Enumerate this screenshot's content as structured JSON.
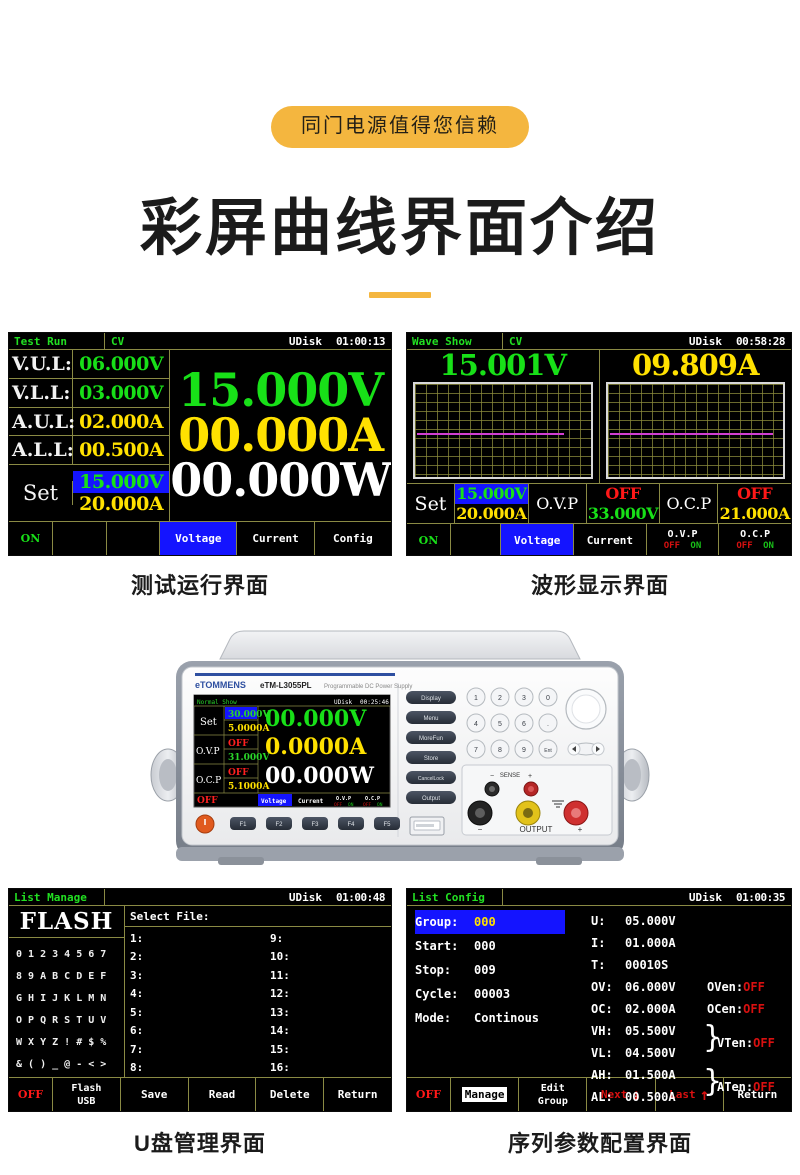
{
  "header": {
    "badge": "同门电源值得您信赖",
    "title": "彩屏曲线界面介绍",
    "accent_color": "#F4B63F"
  },
  "captions": {
    "panel1": "测试运行界面",
    "panel2": "波形显示界面",
    "panel3": "U盘管理界面",
    "panel4": "序列参数配置界面"
  },
  "colors": {
    "green": "#18e018",
    "yellow": "#ffe100",
    "white": "#ffffff",
    "red": "#ff1818",
    "blue_select": "#1414ff",
    "grid_line": "#8a8a44",
    "trace": "#d33fd3"
  },
  "panel_test_run": {
    "status": {
      "mode": "Test Run",
      "cc": "CV",
      "udisk": "UDisk",
      "clock": "01:00:13"
    },
    "limits": [
      {
        "label": "V.U.L:",
        "value": "06.000V",
        "color": "green"
      },
      {
        "label": "V.L.L:",
        "value": "03.000V",
        "color": "green"
      },
      {
        "label": "A.U.L:",
        "value": "02.000A",
        "color": "yellow"
      },
      {
        "label": "A.L.L:",
        "value": "00.500A",
        "color": "yellow"
      }
    ],
    "set": {
      "label": "Set",
      "voltage": "15.000V",
      "current": "20.000A",
      "selected": "voltage"
    },
    "readings": {
      "voltage": "15.000V",
      "current": "00.000A",
      "power": "00.000W"
    },
    "fbar": {
      "output": "ON",
      "keys": [
        "Voltage",
        "Current",
        "Config"
      ],
      "active_key": "Voltage"
    }
  },
  "panel_wave_show": {
    "status": {
      "mode": "Wave Show",
      "cc": "CV",
      "udisk": "UDisk",
      "clock": "00:58:28"
    },
    "plots": [
      {
        "reading": "15.001V",
        "color": "green",
        "trace_fraction": 0.84,
        "trace_y_fraction": 0.53
      },
      {
        "reading": "09.809A",
        "color": "yellow",
        "trace_fraction": 0.93,
        "trace_y_fraction": 0.53
      }
    ],
    "setbar": {
      "set_label": "Set",
      "set_voltage": "15.000V",
      "set_current": "20.000A",
      "ovp_label": "O.V.P",
      "ovp_state": "OFF",
      "ovp_value": "33.000V",
      "ocp_label": "O.C.P",
      "ocp_state": "OFF",
      "ocp_value": "21.000A"
    },
    "fbar": {
      "output": "ON",
      "keys": [
        "Voltage",
        "Current"
      ],
      "active_key": "Voltage",
      "toggles": [
        {
          "title": "O.V.P",
          "off": "OFF",
          "on": "ON"
        },
        {
          "title": "O.C.P",
          "off": "OFF",
          "on": "ON"
        }
      ]
    }
  },
  "panel_list_manage": {
    "status": {
      "mode": "List Manage",
      "cc": "",
      "udisk": "UDisk",
      "clock": "01:00:48"
    },
    "flash_title": "FLASH",
    "char_rows": [
      "0 1 2 3 4 5 6 7",
      "8 9 A B C D E F",
      "G H I J K L M N",
      "O P Q R S T U V",
      "W X Y Z ! # $ %",
      "& ( ) _ @ - < >"
    ],
    "select_file_label": "Select File:",
    "files_col1": [
      "1:",
      "2:",
      "3:",
      "4:",
      "5:",
      "6:",
      "7:",
      "8:"
    ],
    "files_col2": [
      "9:",
      "10:",
      "11:",
      "12:",
      "13:",
      "14:",
      "15:",
      "16:"
    ],
    "fbar": {
      "output": "OFF",
      "source_top": "Flash",
      "source_bottom": "USB",
      "keys": [
        "Save",
        "Read",
        "Delete",
        "Return"
      ]
    }
  },
  "panel_list_config": {
    "status": {
      "mode": "List Config",
      "cc": "",
      "udisk": "UDisk",
      "clock": "01:00:35"
    },
    "left_fields": [
      {
        "key": "Group:",
        "value": "000",
        "highlight": true
      },
      {
        "key": "Start:",
        "value": "000",
        "highlight": false
      },
      {
        "key": "Stop:",
        "value": "009",
        "highlight": false
      },
      {
        "key": "Cycle:",
        "value": "00003",
        "highlight": false
      },
      {
        "key": "Mode:",
        "value": "Continous",
        "highlight": false
      }
    ],
    "right_fields": [
      {
        "key": "U:",
        "value": "05.000V",
        "enable": ""
      },
      {
        "key": "I:",
        "value": "01.000A",
        "enable": ""
      },
      {
        "key": "T:",
        "value": "00010S",
        "enable": ""
      },
      {
        "key": "OV:",
        "value": "06.000V",
        "enable": "OVen:",
        "enable_value": "OFF"
      },
      {
        "key": "OC:",
        "value": "02.000A",
        "enable": "OCen:",
        "enable_value": "OFF"
      },
      {
        "key": "VH:",
        "value": "05.500V",
        "enable": ""
      },
      {
        "key": "VL:",
        "value": "04.500V",
        "enable": ""
      },
      {
        "key": "AH:",
        "value": "01.500A",
        "enable": ""
      },
      {
        "key": "AL:",
        "value": "00.500A",
        "enable": ""
      }
    ],
    "brace_groups": [
      {
        "label": "VTen:",
        "value": "OFF"
      },
      {
        "label": "ATen:",
        "value": "OFF"
      }
    ],
    "fbar": {
      "output": "OFF",
      "manage": "Manage",
      "edit_top": "Edit",
      "edit_bottom": "Group",
      "next": "Next",
      "last": "Last",
      "return": "Return"
    }
  },
  "device": {
    "brand": "eTOMMENS",
    "model": "eTM-L3055PL",
    "subtitle": "Programmable DC Power Supply",
    "screen": {
      "status_mode": "Normal Show",
      "status_udisk": "UDisk",
      "status_clock": "00:25:46",
      "rows": [
        {
          "label": "Set",
          "top": "30.000V",
          "bottom": "5.0000A",
          "top_selected": true
        },
        {
          "label": "O.V.P",
          "top": "OFF",
          "bottom": "31.000V",
          "top_selected": false
        },
        {
          "label": "O.C.P",
          "top": "OFF",
          "bottom": "5.1000A",
          "top_selected": false
        }
      ],
      "readings": {
        "voltage": "00.000V",
        "current": "0.0000A",
        "power": "00.000W"
      },
      "fbar": {
        "output": "OFF",
        "keys": [
          "Voltage",
          "Current"
        ],
        "active_key": "Voltage",
        "toggles": [
          {
            "title": "O.V.P",
            "off": "OFF",
            "on": "ON"
          },
          {
            "title": "O.C.P",
            "off": "OFF",
            "on": "ON"
          }
        ]
      }
    },
    "side_buttons": [
      "Display",
      "Menu",
      "MoreFun",
      "Store",
      "CancelLock",
      "Output"
    ],
    "keypad": [
      "1",
      "2",
      "3",
      "0",
      "4",
      "5",
      "6",
      ".",
      "7",
      "8",
      "9",
      "Ent"
    ],
    "function_keys": [
      "F1",
      "F2",
      "F3",
      "F4",
      "F5"
    ],
    "terminals": {
      "sense": "SENSE",
      "output": "OUTPUT",
      "minus": "−",
      "plus": "+"
    }
  }
}
